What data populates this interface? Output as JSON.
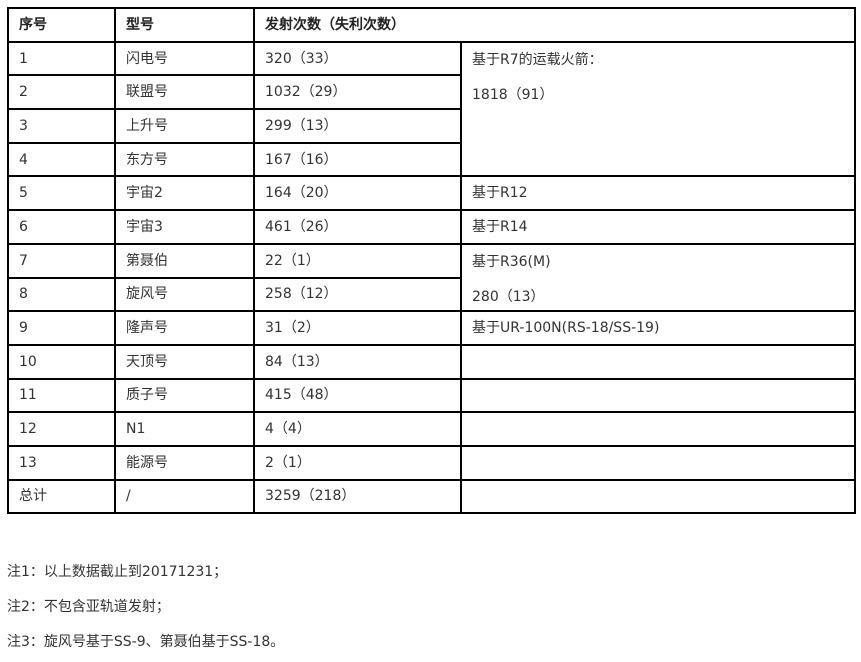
{
  "table": {
    "headers": {
      "index": "序号",
      "model": "型号",
      "launches": "发射次数（失利次数）"
    },
    "rows": [
      {
        "index": "1",
        "model": "闪电号",
        "launches": "320（33）"
      },
      {
        "index": "2",
        "model": "联盟号",
        "launches": "1032（29）"
      },
      {
        "index": "3",
        "model": "上升号",
        "launches": "299（13）"
      },
      {
        "index": "4",
        "model": "东方号",
        "launches": "167（16）"
      },
      {
        "index": "5",
        "model": "宇宙2",
        "launches": "164（20）"
      },
      {
        "index": "6",
        "model": "宇宙3",
        "launches": "461（26）"
      },
      {
        "index": "7",
        "model": "第聂伯",
        "launches": "22（1）"
      },
      {
        "index": "8",
        "model": "旋风号",
        "launches": "258（12）"
      },
      {
        "index": "9",
        "model": "隆声号",
        "launches": "31（2）"
      },
      {
        "index": "10",
        "model": "天顶号",
        "launches": "84（13）"
      },
      {
        "index": "11",
        "model": "质子号",
        "launches": "415（48）"
      },
      {
        "index": "12",
        "model": "N1",
        "launches": "4（4）"
      },
      {
        "index": "13",
        "model": "能源号",
        "launches": "2（1）"
      }
    ],
    "groups": [
      {
        "label": "基于R7的运载火箭：",
        "total": "1818（91）"
      },
      {
        "label": "基于R12"
      },
      {
        "label": "基于R14"
      },
      {
        "label": "基于R36(M)",
        "total": "280（13）"
      },
      {
        "label": "基于UR-100N(RS-18/SS-19)"
      }
    ],
    "total_row": {
      "index": "总计",
      "model": "/",
      "launches": "3259（218）"
    }
  },
  "notes": [
    "注1：以上数据截止到20171231；",
    "注2：不包含亚轨道发射；",
    "注3：旋风号基于SS-9、第聂伯基于SS-18。"
  ]
}
